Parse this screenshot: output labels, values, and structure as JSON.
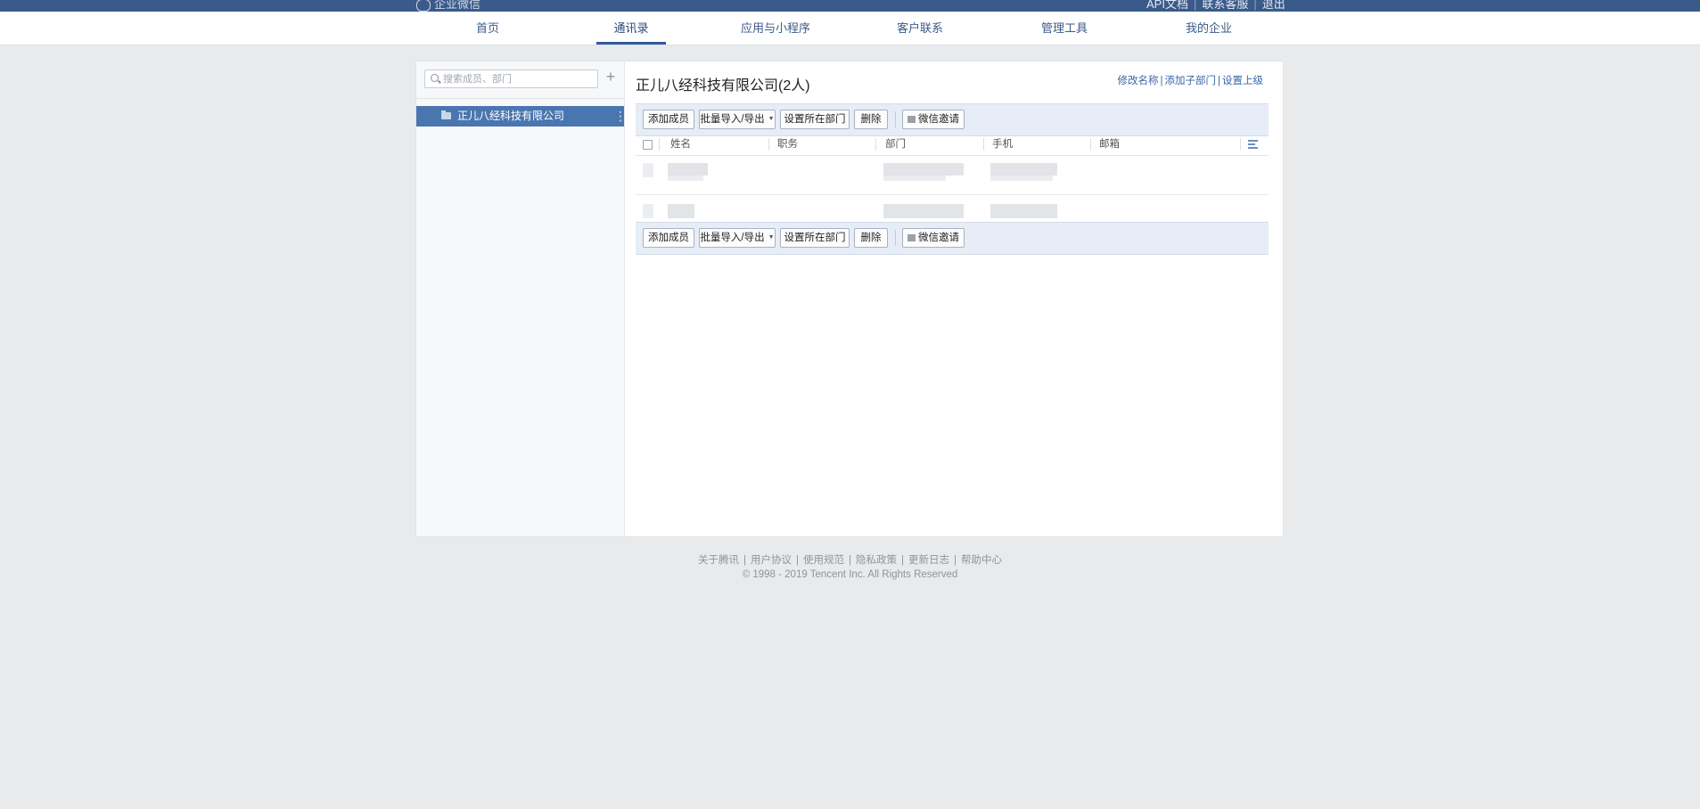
{
  "topbar": {
    "logo_text": "企业微信",
    "links": [
      "API文档",
      "联系客服",
      "退出"
    ]
  },
  "nav": {
    "tabs": [
      {
        "label": "首页",
        "active": false
      },
      {
        "label": "通讯录",
        "active": true
      },
      {
        "label": "应用与小程序",
        "active": false
      },
      {
        "label": "客户联系",
        "active": false
      },
      {
        "label": "管理工具",
        "active": false
      },
      {
        "label": "我的企业",
        "active": false
      }
    ]
  },
  "sidebar": {
    "search_placeholder": "搜索成员、部门",
    "add_icon": "+",
    "department": "正儿八经科技有限公司"
  },
  "main": {
    "title": "正儿八经科技有限公司(2人)",
    "links": [
      "修改名称",
      "添加子部门",
      "设置上级"
    ],
    "link_separator": "|",
    "toolbar": {
      "add_member": "添加成员",
      "import_export": "批量导入/导出",
      "set_department": "设置所在部门",
      "delete": "删除",
      "wechat_invite": "微信邀请"
    },
    "columns": [
      "姓名",
      "职务",
      "部门",
      "手机",
      "邮箱"
    ]
  },
  "footer": {
    "links": [
      "关于腾讯",
      "用户协议",
      "使用规范",
      "隐私政策",
      "更新日志",
      "帮助中心"
    ],
    "separator": "|",
    "copyright": "© 1998 - 2019 Tencent Inc. All Rights Reserved"
  },
  "colors": {
    "topbar": "#3a5a8a",
    "accent": "#4a76b0",
    "link": "#3a65a8",
    "toolbar_bg": "#e6edf6",
    "page_bg": "#e9eaec"
  }
}
